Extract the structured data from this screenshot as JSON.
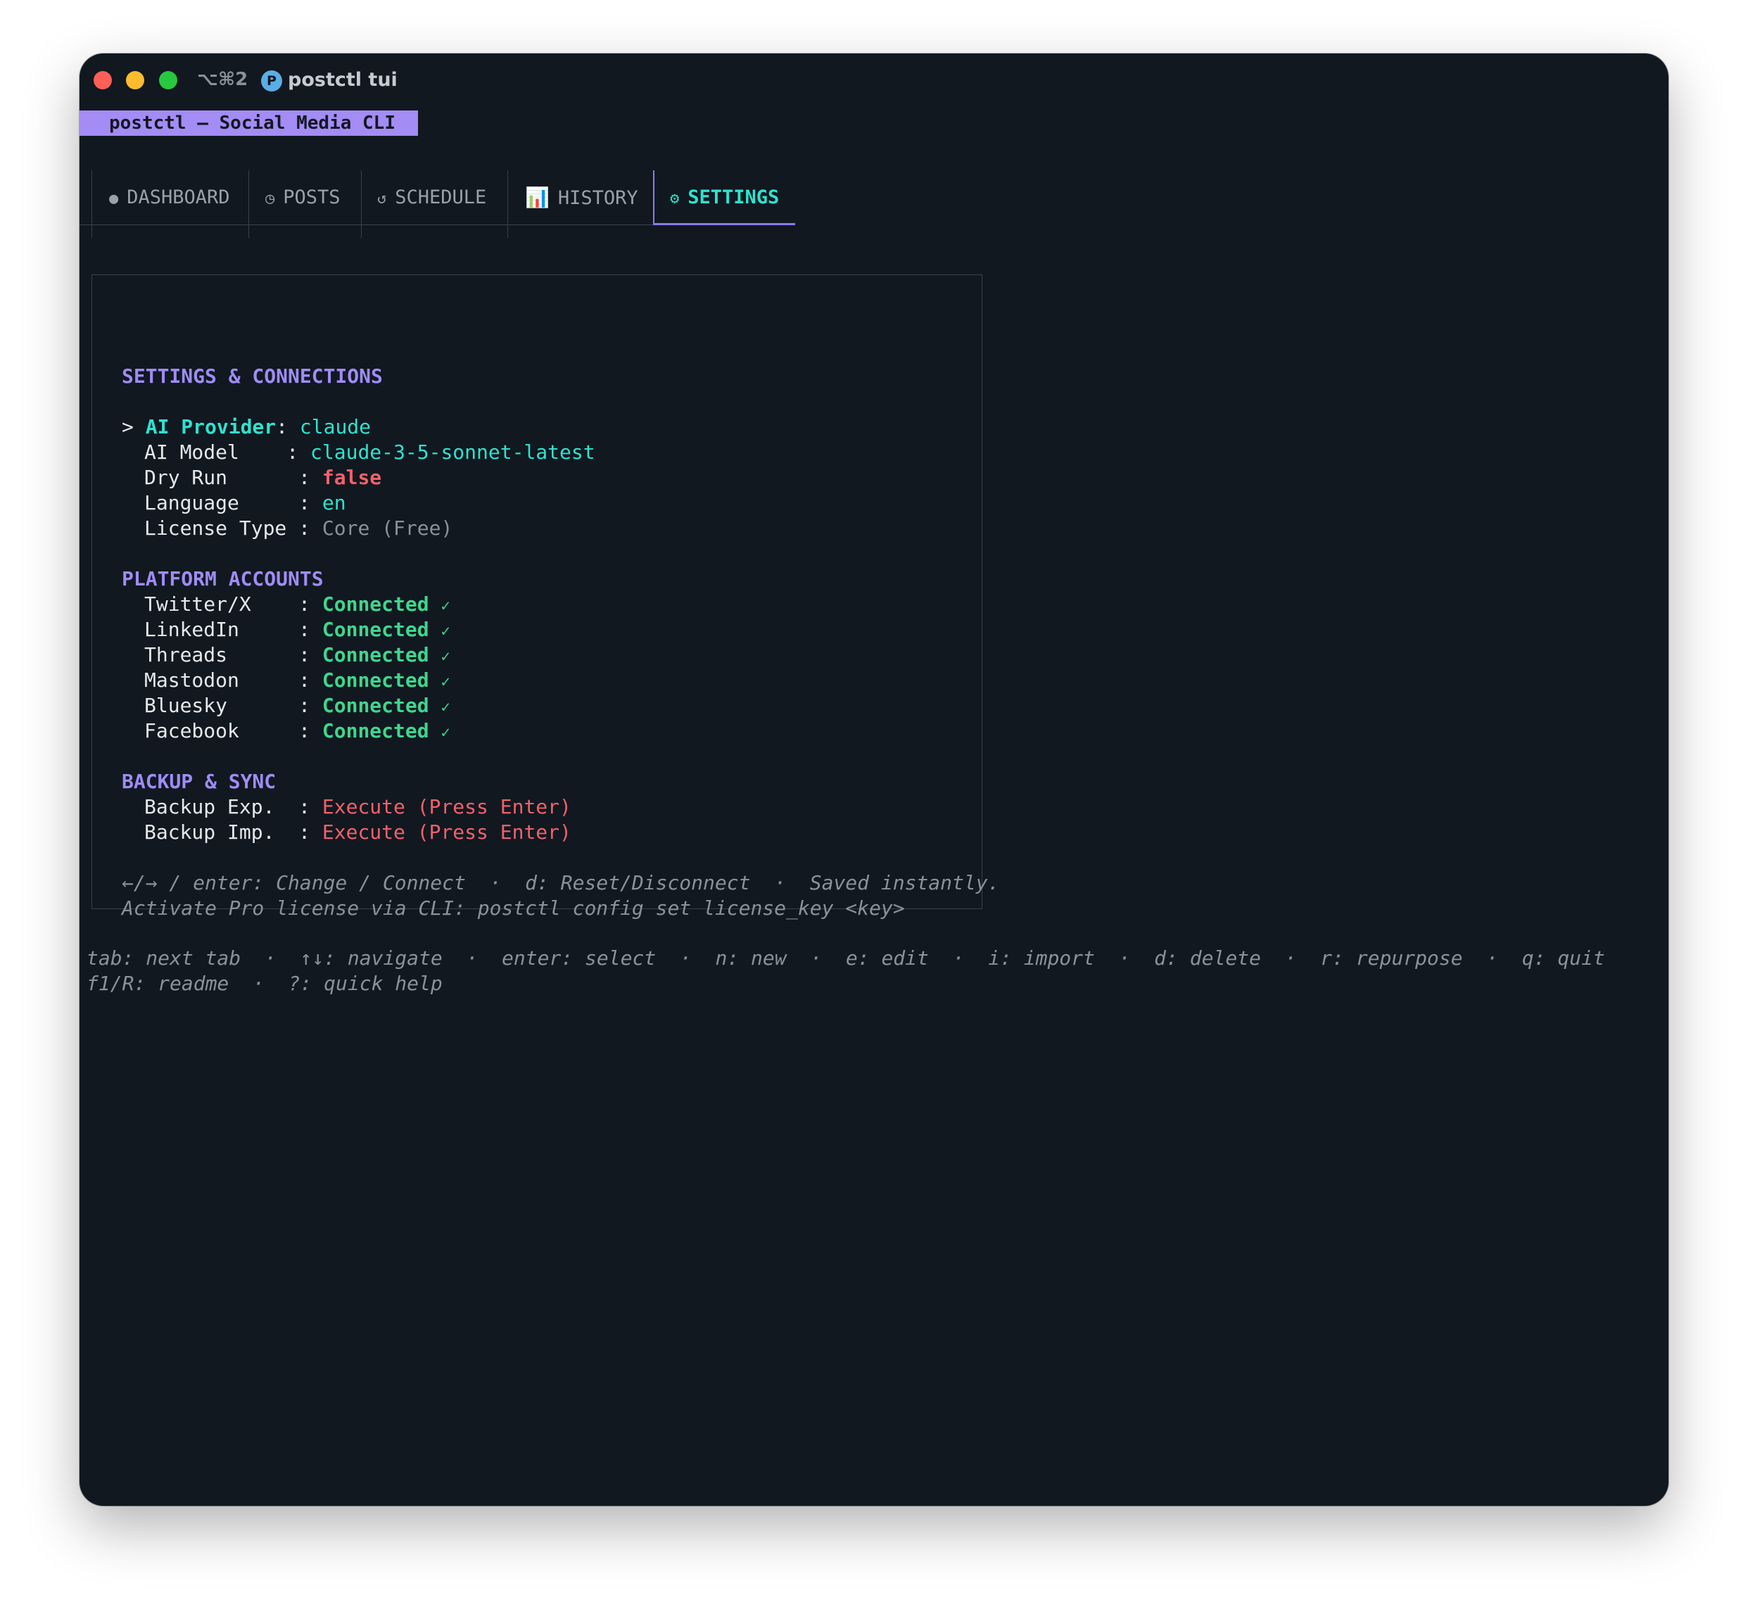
{
  "window": {
    "shortcut": "⌥⌘2",
    "app_icon_letter": "P",
    "title": "postctl tui"
  },
  "banner": "postctl — Social Media CLI",
  "tabs": [
    {
      "icon": "●",
      "label": "DASHBOARD"
    },
    {
      "icon": "◷",
      "label": "POSTS"
    },
    {
      "icon": "↺",
      "label": "SCHEDULE"
    },
    {
      "icon": "📊",
      "label": "HISTORY"
    },
    {
      "icon": "⚙",
      "label": "SETTINGS",
      "active": true
    }
  ],
  "settings": {
    "heading": "SETTINGS & CONNECTIONS",
    "cursor": ">",
    "rows": [
      {
        "label": "AI Provider",
        "sep": ": ",
        "value": "claude"
      },
      {
        "label": "AI Model    ",
        "sep": ": ",
        "value": "claude-3-5-sonnet-latest"
      },
      {
        "label": "Dry Run      ",
        "sep": ": ",
        "value": "false"
      },
      {
        "label": "Language     ",
        "sep": ": ",
        "value": "en"
      },
      {
        "label": "License Type ",
        "sep": ": ",
        "value": "Core (Free)"
      }
    ]
  },
  "platforms": {
    "heading": "PLATFORM ACCOUNTS",
    "status_text": "Connected",
    "check": "✓",
    "items": [
      {
        "label": "Twitter/X    ",
        "sep": ": "
      },
      {
        "label": "LinkedIn     ",
        "sep": ": "
      },
      {
        "label": "Threads      ",
        "sep": ": "
      },
      {
        "label": "Mastodon     ",
        "sep": ": "
      },
      {
        "label": "Bluesky      ",
        "sep": ": "
      },
      {
        "label": "Facebook     ",
        "sep": ": "
      }
    ]
  },
  "backup": {
    "heading": "BACKUP & SYNC",
    "items": [
      {
        "label": "Backup Exp.  ",
        "sep": ": ",
        "action": "Execute (Press Enter)"
      },
      {
        "label": "Backup Imp.  ",
        "sep": ": ",
        "action": "Execute (Press Enter)"
      }
    ]
  },
  "panel_hints": [
    "←/→ / enter: Change / Connect  ·  d: Reset/Disconnect  ·  Saved instantly.",
    "Activate Pro license via CLI: postctl config set license_key <key>"
  ],
  "footer": [
    "tab: next tab  ·  ↑↓: navigate  ·  enter: select  ·  n: new  ·  e: edit  ·  i: import  ·  d: delete  ·  r: repurpose  ·  q: quit",
    "f1/R: readme  ·  ?: quick help"
  ],
  "colors": {
    "background": "#111820",
    "accent_purple": "#a38cf4",
    "accent_cyan": "#2ee3cf",
    "status_green": "#3fd68d",
    "status_red": "#f2616a",
    "muted": "#8a919b"
  }
}
